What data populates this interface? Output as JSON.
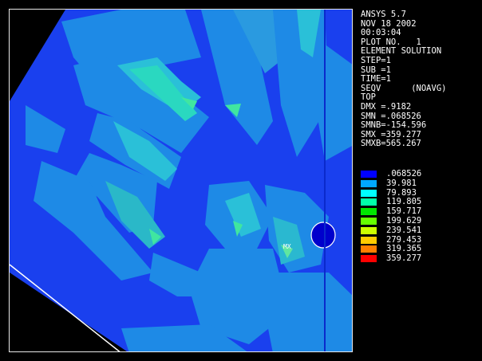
{
  "info": [
    "ANSYS 5.7",
    "NOV 18 2002",
    "00:03:04",
    "PLOT NO.   1",
    "ELEMENT SOLUTION",
    "STEP=1",
    "SUB =1",
    "TIME=1",
    "SEQV      (NOAVG)",
    "TOP",
    "DMX =.9182",
    "SMN =.068526",
    "SMNB=-154.596",
    "SMX =359.277",
    "SMXB=565.267"
  ],
  "legend": [
    {
      "value": ".068526",
      "color": "#0000ff"
    },
    {
      "value": "39.981",
      "color": "#00a8ff"
    },
    {
      "value": "79.893",
      "color": "#00ffff"
    },
    {
      "value": "119.805",
      "color": "#00ffaa"
    },
    {
      "value": "159.717",
      "color": "#00e600"
    },
    {
      "value": "199.629",
      "color": "#66ff00"
    },
    {
      "value": "239.541",
      "color": "#ccff00"
    },
    {
      "value": "279.453",
      "color": "#ffcc00"
    },
    {
      "value": "319.365",
      "color": "#ff7f00"
    },
    {
      "value": "359.277",
      "color": "#ff0000"
    }
  ],
  "plot": {
    "max_marker": "MX"
  }
}
